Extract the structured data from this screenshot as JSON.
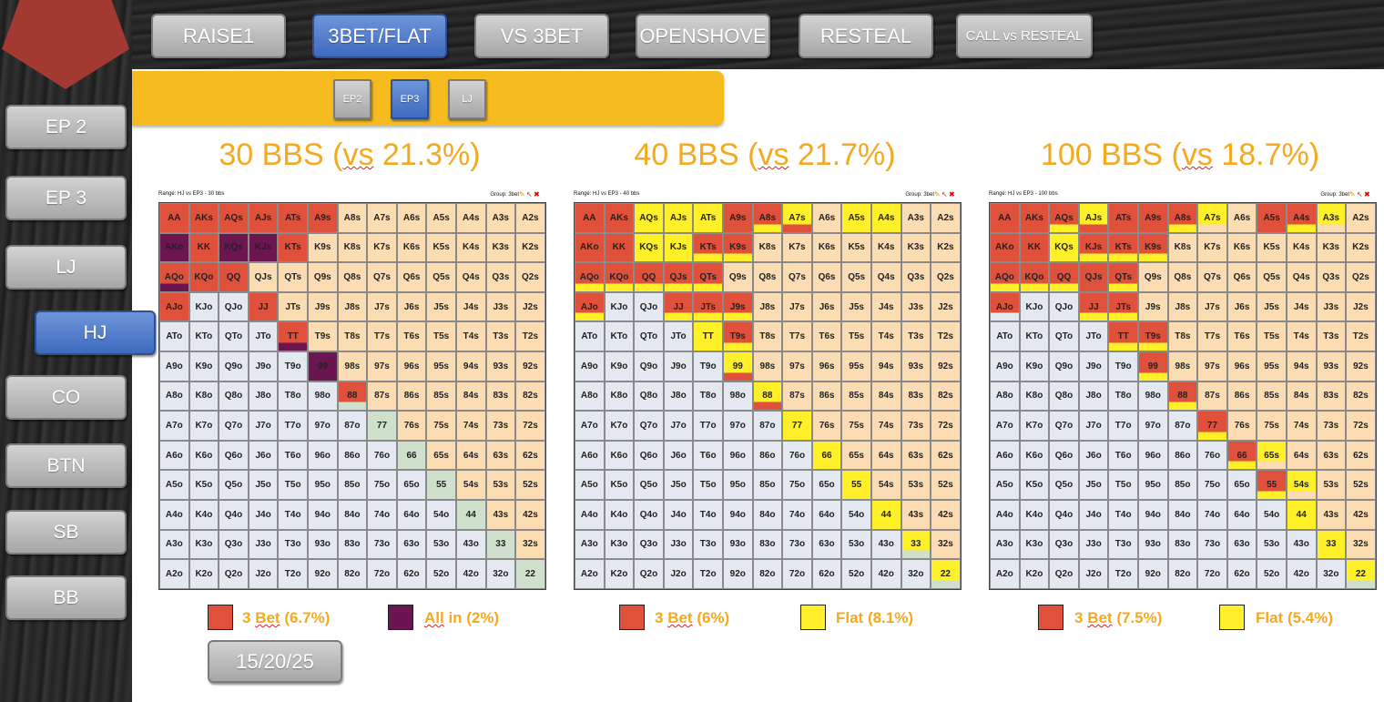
{
  "tabs": [
    "RAISE1",
    "3BET/FLAT",
    "VS 3BET",
    "OPENSHOVE",
    "RESTEAL",
    "CALL vs RESTEAL"
  ],
  "active_tab": "3BET/FLAT",
  "positions": [
    "EP 2",
    "EP 3",
    "LJ",
    "HJ",
    "CO",
    "BTN",
    "SB",
    "BB"
  ],
  "active_position": "HJ",
  "opponents": [
    "EP2",
    "EP3",
    "LJ"
  ],
  "active_opponent": "EP3",
  "stack_button": "15/20/25",
  "colors": {
    "threebet": "#e0513b",
    "allin": "#6b1650",
    "flat": "#fff02a",
    "suited": "#fbdcb3",
    "offsuit": "#e3e8f1",
    "pair": "#cfe0cc",
    "accent": "#f4a91f",
    "active": "#4471c4"
  },
  "ranks": [
    "A",
    "K",
    "Q",
    "J",
    "T",
    "9",
    "8",
    "7",
    "6",
    "5",
    "4",
    "3",
    "2"
  ],
  "panels": [
    {
      "title_pre": "30 BBS (",
      "title_u": "vs",
      "title_post": " 21.3%)",
      "range_label": "Range: HJ vs EP3 - 30 bbs",
      "group_label": "Group: 3bet",
      "legend": [
        {
          "pre": "3 ",
          "u": "Bet",
          "post": " (6.7%)",
          "color": "#e0513b"
        },
        {
          "pre": "",
          "u": "All",
          "post": " in (2%)",
          "color": "#6b1650"
        }
      ],
      "actions": {
        "AA": "r",
        "AKs": "r",
        "AQs": "r",
        "AJs": "r",
        "ATs": "r",
        "A9s": "r",
        "AKo": "a",
        "KK": "r",
        "KQs": "a",
        "KJs": "a",
        "KTs": "r",
        "AQo": "r/a",
        "KQo": "r",
        "QQ": "r",
        "AJo": "r",
        "JJ": "r",
        "TT": "r/a",
        "99": "a",
        "88": "r/"
      }
    },
    {
      "title_pre": "40 BBS (",
      "title_u": "vs",
      "title_post": " 21.7%)",
      "range_label": "Range: HJ vs EP3 - 40 bbs",
      "group_label": "Group: 3bet",
      "legend": [
        {
          "pre": "3 ",
          "u": "Bet",
          "post": " (6%)",
          "color": "#e0513b"
        },
        {
          "pre": "",
          "u": "",
          "post": "Flat (8.1%)",
          "color": "#fff02a"
        }
      ],
      "actions": {
        "AA": "r",
        "AKs": "r",
        "AQs": "f",
        "AJs": "f",
        "ATs": "f",
        "A9s": "r",
        "A8s": "r/f",
        "A7s": "f/r",
        "A5s": "f",
        "A4s": "f",
        "AKo": "r",
        "KK": "r",
        "KQs": "f",
        "KJs": "f",
        "KTs": "r/f",
        "K9s": "r/f",
        "AQo": "r/f",
        "KQo": "r/f",
        "QQ": "r/f",
        "QJs": "r/f",
        "QTs": "r/f",
        "AJo": "r/f",
        "JJ": "r/f",
        "JTs": "r/f",
        "J9s": "r/f",
        "TT": "f",
        "T9s": "r/f",
        "99": "f/r",
        "88": "f/r",
        "77": "f",
        "66": "f",
        "55": "f",
        "44": "f",
        "33": "f/",
        "22": "f/"
      }
    },
    {
      "title_pre": "100 BBS (",
      "title_u": "vs",
      "title_post": " 18.7%)",
      "range_label": "Range: HJ vs EP3 - 100 bbs",
      "group_label": "Group: 3bet",
      "legend": [
        {
          "pre": "3 ",
          "u": "Bet",
          "post": " (7.5%)",
          "color": "#e0513b"
        },
        {
          "pre": "",
          "u": "",
          "post": "Flat (5.4%)",
          "color": "#fff02a"
        }
      ],
      "actions": {
        "AA": "r",
        "AKs": "r",
        "AQs": "r/f",
        "AJs": "f/r",
        "ATs": "r",
        "A9s": "r",
        "A8s": "r/f",
        "A7s": "f/",
        "A5s": "r",
        "A4s": "r/f",
        "A3s": "f/",
        "AKo": "r",
        "KK": "r",
        "KQs": "f",
        "KJs": "r/f",
        "KTs": "r/f",
        "K9s": "r/f",
        "AQo": "r/f",
        "KQo": "r/f",
        "QQ": "r/f",
        "QJs": "r",
        "QTs": "r/f",
        "AJo": "r/",
        "JJ": "r/f",
        "JTs": "r/f",
        "TT": "r/f",
        "T9s": "r/f",
        "99": "r/f",
        "88": "r/f",
        "77": "r/f",
        "66": "r/f",
        "65s": "f/",
        "55": "r/f",
        "54s": "f/",
        "44": "f",
        "33": "f",
        "22": "f/"
      }
    }
  ]
}
